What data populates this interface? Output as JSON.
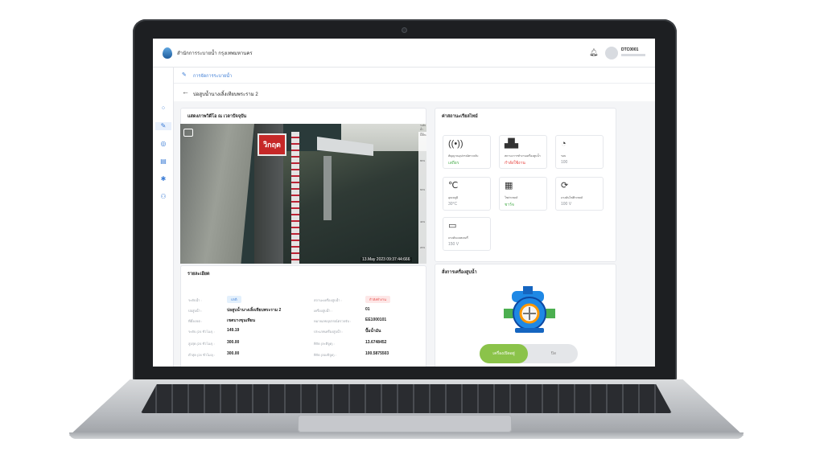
{
  "header": {
    "org_name": "สำนักการระบายน้ำ กรุงเทพมหานคร",
    "user_name": "DTC0001"
  },
  "breadcrumb": {
    "section": "การจัดการระบายน้ำ"
  },
  "page": {
    "title": "บ่อสูบน้ำนางเลิ้งเทียบพระราม 2"
  },
  "video": {
    "title": "แสดงภาพวิดีโอ ณ เวลาปัจจุบัน",
    "sign_text": "วิกฤต",
    "timestamp": "13.May 2023   09:37:44:666",
    "scale_header": "ระดับน้ำ (%)",
    "scale_ticks": [
      "100%",
      "80%",
      "60%",
      "40%",
      "20%"
    ]
  },
  "details": {
    "title": "รายละเอียด",
    "rows_left": [
      {
        "label": "ระดับน้ำ :",
        "value": "ปกติ"
      },
      {
        "label": "บ่อสูบน้ำ :",
        "value": "บ่อสูบน้ำนางเลิ้งเทียบพระราม 2"
      },
      {
        "label": "ที่ตั้ง/เขต :",
        "value": "เขตบางขุนเทียน"
      },
      {
        "label": "ระดับ (24 ชั่วโมง) :",
        "value": "149.19"
      },
      {
        "label": "สูงสุด (24 ชั่วโมง) :",
        "value": "300.00"
      },
      {
        "label": "ต่ำสุด (24 ชั่วโมง) :",
        "value": "300.00"
      }
    ],
    "rows_right": [
      {
        "label": "สถานะเครื่องสูบน้ำ :",
        "value": "กำลังทำงาน"
      },
      {
        "label": "เครื่องสูบน้ำ :",
        "value": "01"
      },
      {
        "label": "หมายเลขอุปกรณ์ตรวจจับ :",
        "value": "EE1000101"
      },
      {
        "label": "ประเภทเครื่องสูบน้ำ :",
        "value": "ปั๊มน้ำมัน"
      },
      {
        "label": "พิกัด (ละติจูด) :",
        "value": "13.6748452"
      },
      {
        "label": "พิกัด (ลองจิจูด) :",
        "value": "100.5875503"
      }
    ]
  },
  "status": {
    "title": "ค่าสถานะเรียลไทม์",
    "tiles": [
      {
        "icon": "signal-icon",
        "glyph": "((•))",
        "label": "สัญญาณอุปกรณ์ตรวจจับ",
        "value": "เสถียร",
        "color": "#4caf50"
      },
      {
        "icon": "factory-icon",
        "glyph": "▟▙",
        "label": "สถานะการทำงานเครื่องสูบน้ำ",
        "value": "กำลังใช้งาน",
        "color": "#e53935"
      },
      {
        "icon": "gauge-icon",
        "glyph": "◔",
        "label": "รอบ",
        "value": "100",
        "color": "#8a8f96"
      },
      {
        "icon": "thermometer-icon",
        "glyph": "℃",
        "label": "อุณหภูมิ",
        "value": "30°C",
        "color": "#8a8f96"
      },
      {
        "icon": "solar-panel-icon",
        "glyph": "▦",
        "label": "โซล่าเซลล์",
        "value": "ชาร์จ",
        "color": "#4caf50"
      },
      {
        "icon": "battery-cycle-icon",
        "glyph": "⟳",
        "label": "แรงดันไฟฟ้าเซลล์",
        "value": "100 V",
        "color": "#8a8f96"
      },
      {
        "icon": "battery-icon",
        "glyph": "▭",
        "label": "แรงดันแบตเตอรี่",
        "value": "150 V",
        "color": "#8a8f96"
      }
    ]
  },
  "pump_control": {
    "title": "สั่งการเครื่องสูบน้ำ",
    "on_label": "เครื่องเปิดอยู่",
    "off_label": "ปิด"
  },
  "colors": {
    "accent": "#3a7bd5",
    "ok": "#4caf50",
    "alert": "#e53935",
    "toggle_on": "#8bc34a"
  }
}
